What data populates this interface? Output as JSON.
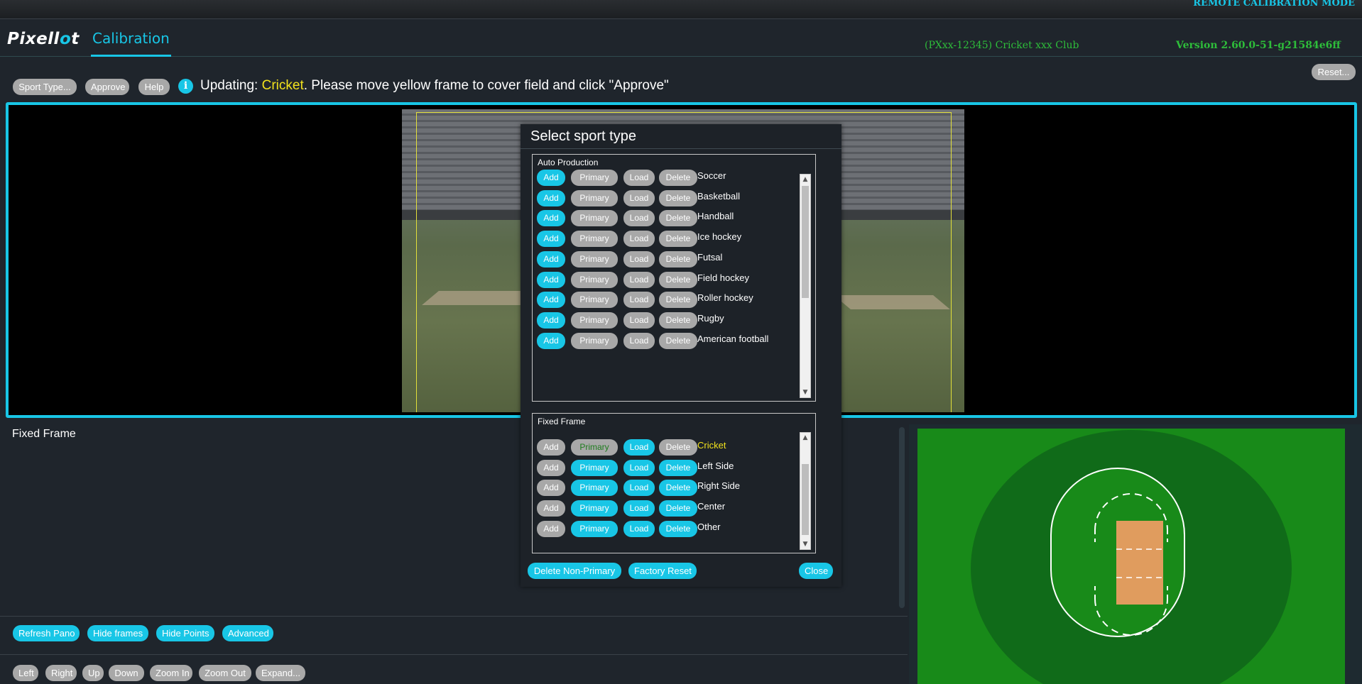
{
  "topbar": {
    "mode": "REMOTE CALIBRATION MODE"
  },
  "header": {
    "logo": "Pixellot",
    "tab": "Calibration",
    "device": "(PXxx-12345) Cricket xxx Club",
    "version": "Version 2.60.0-51-g21584e6ff"
  },
  "toolbar": {
    "sport_type": "Sport Type...",
    "approve": "Approve",
    "help": "Help",
    "reset": "Reset..."
  },
  "status": {
    "prefix": "Updating: ",
    "sport": "Cricket",
    "suffix": ". Please move yellow frame to cover field and click \"Approve\""
  },
  "fixed_frame_label": "Fixed Frame",
  "bottom_buttons": {
    "refresh_pano": "Refresh Pano",
    "hide_frames": "Hide frames",
    "hide_points": "Hide Points",
    "advanced": "Advanced"
  },
  "nav_buttons": {
    "left": "Left",
    "right": "Right",
    "up": "Up",
    "down": "Down",
    "zoom_in": "Zoom In",
    "zoom_out": "Zoom Out",
    "expand": "Expand..."
  },
  "modal": {
    "title": "Select sport type",
    "row_labels": {
      "add": "Add",
      "primary": "Primary",
      "load": "Load",
      "delete": "Delete"
    },
    "auto_production": {
      "label": "Auto Production",
      "sports": [
        "Soccer",
        "Basketball",
        "Handball",
        "Ice hockey",
        "Futsal",
        "Field hockey",
        "Roller hockey",
        "Rugby",
        "American football"
      ]
    },
    "fixed_frame": {
      "label": "Fixed Frame",
      "sports": [
        "Cricket",
        "Left Side",
        "Right Side",
        "Center",
        "Other"
      ]
    },
    "footer": {
      "delete_non_primary": "Delete Non-Primary",
      "factory_reset": "Factory Reset",
      "close": "Close"
    }
  },
  "colors": {
    "accent": "#18c6e6",
    "version_green": "#2ebd3a",
    "highlight_yellow": "#f2e21d",
    "field_green": "#188a19"
  }
}
